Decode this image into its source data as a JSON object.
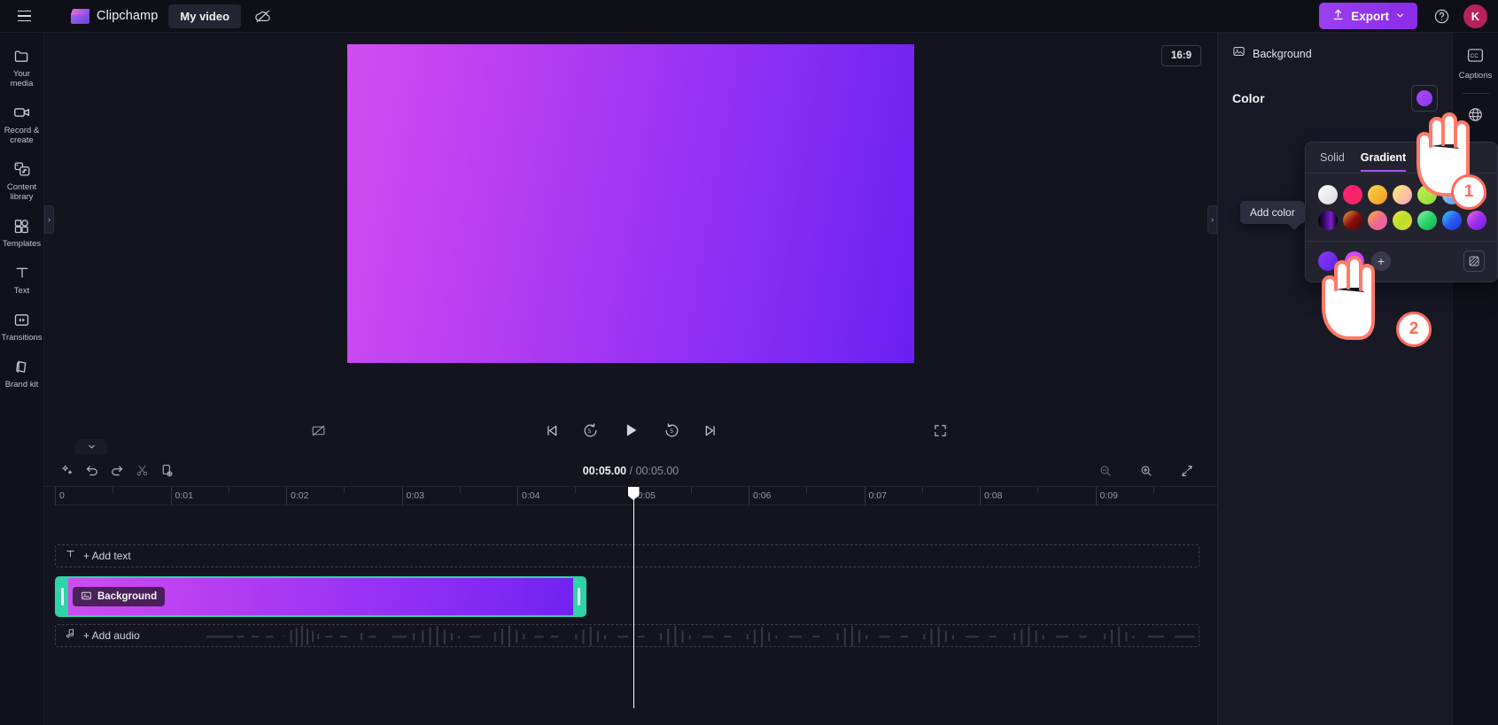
{
  "app": {
    "brand_name": "Clipchamp",
    "project_name": "My video"
  },
  "topbar": {
    "menu_icon": "hamburger-icon",
    "logo_icon": "clipchamp-logo-icon",
    "cloud_off_icon": "cloud-off-icon",
    "export_label": "Export",
    "export_icon": "upload-icon",
    "export_chevron": "chevron-down-icon",
    "help_icon": "help-circle-icon",
    "avatar_initial": "K",
    "avatar_color": "#b7225c",
    "export_color": "#9a3ff0"
  },
  "left_rail": {
    "items": [
      {
        "label": "Your media",
        "icon": "folder-icon"
      },
      {
        "label": "Record & create",
        "icon": "video-camera-icon"
      },
      {
        "label": "Content library",
        "icon": "content-library-icon"
      },
      {
        "label": "Templates",
        "icon": "templates-grid-icon"
      },
      {
        "label": "Text",
        "icon": "text-t-icon"
      },
      {
        "label": "Transitions",
        "icon": "transitions-icon"
      },
      {
        "label": "Brand kit",
        "icon": "brand-kit-icon"
      }
    ]
  },
  "stage": {
    "aspect_ratio": "16:9",
    "canvas_gradient_from": "#cf4ef0",
    "canvas_gradient_to": "#6a20f2",
    "collapse_left_icon": "chevron-right-icon",
    "collapse_right_icon": "chevron-right-icon"
  },
  "playback": {
    "captions_toggle_icon": "captions-off-icon",
    "skip_start_icon": "skip-to-start-icon",
    "back5_icon": "rewind-5-icon",
    "play_icon": "play-icon",
    "forward5_icon": "forward-5-icon",
    "skip_end_icon": "skip-to-end-icon",
    "fullscreen_icon": "fullscreen-icon"
  },
  "timeline": {
    "collapse_chevron_icon": "chevron-down-icon",
    "tools": [
      {
        "icon": "magic-wand-icon",
        "name": "auto-compose"
      },
      {
        "icon": "undo-icon",
        "name": "undo"
      },
      {
        "icon": "redo-icon",
        "name": "redo"
      },
      {
        "icon": "scissors-icon",
        "name": "split"
      },
      {
        "icon": "duplicate-icon",
        "name": "duplicate"
      }
    ],
    "current_time": "00:05.00",
    "separator": "/",
    "total_time": "00:05.00",
    "zoom_out_icon": "zoom-out-icon",
    "zoom_in_icon": "zoom-in-icon",
    "fit_icon": "fit-to-screen-icon",
    "ruler_labels": [
      "0",
      "0:01",
      "0:02",
      "0:03",
      "0:04",
      "0:05",
      "0:06",
      "0:07",
      "0:08",
      "0:09"
    ],
    "playhead_time": "0:05",
    "tracks": {
      "add_text_label": "+ Add text",
      "add_text_icon": "text-t-icon",
      "add_audio_label": "+ Add audio",
      "add_audio_icon": "music-note-icon",
      "clip": {
        "label": "Background",
        "icon": "background-icon",
        "selected": true,
        "selection_color": "#2ed3a7"
      }
    }
  },
  "right_panel": {
    "header_label": "Background",
    "header_icon": "background-icon",
    "color_label": "Color",
    "selected_swatch_color": "#8f35f2"
  },
  "right_rail": {
    "items": [
      {
        "label": "Captions",
        "icon": "cc-icon"
      }
    ]
  },
  "color_popover": {
    "tabs": [
      {
        "label": "Solid",
        "active": false
      },
      {
        "label": "Gradient",
        "active": true
      }
    ],
    "active_tab_underline": "#a855f7",
    "tooltip_text": "Add color",
    "add_button_icon": "plus-icon",
    "eyedropper_icon": "eyedropper-icon",
    "preset_swatches": [
      "linear-gradient(135deg,#ffffff,#d7d7dd)",
      "linear-gradient(135deg,#ff1f7a,#f2275f)",
      "linear-gradient(135deg,#fbd24e,#f09a1c)",
      "linear-gradient(135deg,#fdf06a,#ff9ec7)",
      "linear-gradient(135deg,#c3f04e,#8ddb3a)",
      "linear-gradient(135deg,#8de0ff,#4f8ef7)",
      "linear-gradient(135deg,#f7a8ff,#b24bf0)",
      "linear-gradient(90deg,#000000,#3a0a6e,#7a1fd0,#000000)",
      "linear-gradient(135deg,#f2a33c,#8c0d0d,#4a0505)",
      "linear-gradient(135deg,#f4b63a,#f06a8a,#e85fb0)",
      "linear-gradient(135deg,#f5e03c,#b8e02e,#f3d02a)",
      "linear-gradient(135deg,#8ef0a0,#2bd66a,#17a84f)",
      "linear-gradient(135deg,#31d6f7,#2b5cf0,#1c2fd6)",
      "linear-gradient(135deg,#f06ad6,#a02ef0,#6a1fd6)"
    ],
    "custom_swatches": [
      "linear-gradient(135deg,#d94ef5,#b53cf2)",
      "linear-gradient(135deg,#8a3cf5,#5a1fe8)"
    ]
  },
  "annotations": {
    "steps": [
      {
        "number": "1",
        "color": "#ff6b5a"
      },
      {
        "number": "2",
        "color": "#ff6b5a"
      }
    ],
    "cursor_icon": "pointing-hand-cursor"
  }
}
